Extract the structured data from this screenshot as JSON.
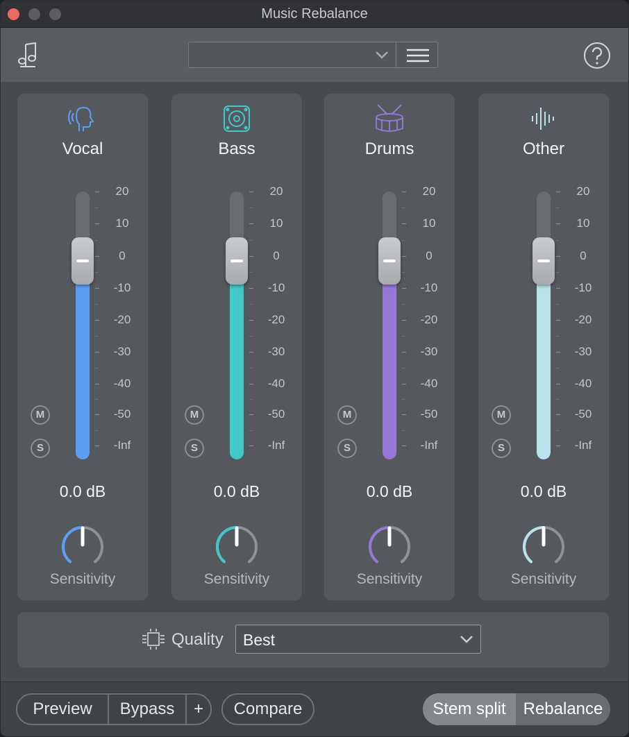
{
  "window": {
    "title": "Music Rebalance"
  },
  "toolbar": {
    "music_icon": "music-note-icon",
    "preset_value": "",
    "preset_menu_icon": "hamburger-menu-icon",
    "help_icon": "question-mark-icon"
  },
  "scale_labels": [
    "20",
    "10",
    "0",
    "-10",
    "-20",
    "-30",
    "-40",
    "-50",
    "-Inf"
  ],
  "channels": [
    {
      "name": "Vocal",
      "icon": "vocal-head-icon",
      "color": "#5b9ff5",
      "gain": "0.0 dB",
      "sensitivity_label": "Sensitivity",
      "mute": "M",
      "solo": "S",
      "fader_level_db": 0,
      "sensitivity_level": 0.5
    },
    {
      "name": "Bass",
      "icon": "speaker-icon",
      "color": "#43c8c8",
      "gain": "0.0 dB",
      "sensitivity_label": "Sensitivity",
      "mute": "M",
      "solo": "S",
      "fader_level_db": 0,
      "sensitivity_level": 0.5
    },
    {
      "name": "Drums",
      "icon": "drum-icon",
      "color": "#9478d6",
      "gain": "0.0 dB",
      "sensitivity_label": "Sensitivity",
      "mute": "M",
      "solo": "S",
      "fader_level_db": 0,
      "sensitivity_level": 0.5
    },
    {
      "name": "Other",
      "icon": "waveform-icon",
      "color": "#b8e3ea",
      "gain": "0.0 dB",
      "sensitivity_label": "Sensitivity",
      "mute": "M",
      "solo": "S",
      "fader_level_db": 0,
      "sensitivity_level": 0.5
    }
  ],
  "quality": {
    "label": "Quality",
    "value": "Best",
    "icon": "processor-chip-icon"
  },
  "bottom": {
    "preview": "Preview",
    "bypass": "Bypass",
    "plus": "+",
    "compare": "Compare",
    "stem_split": "Stem split",
    "second_mode": "Rebalance"
  }
}
